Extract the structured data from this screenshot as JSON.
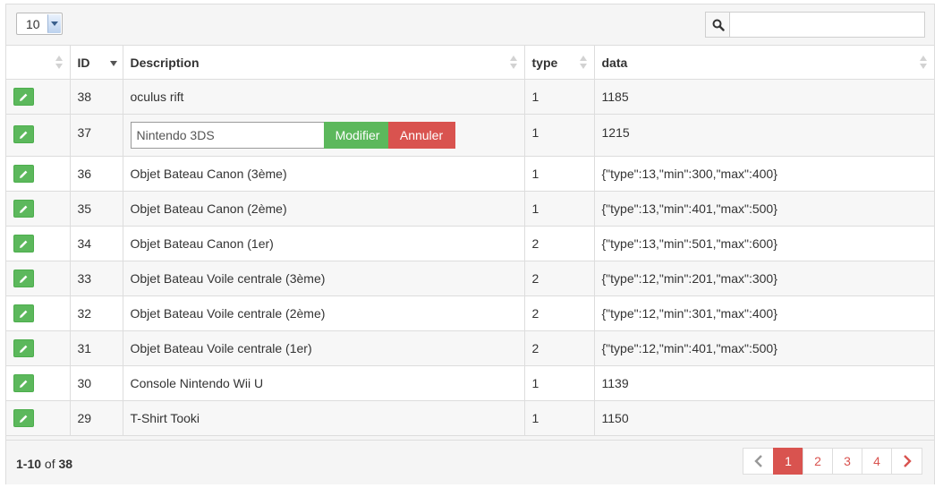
{
  "toolbar": {
    "page_size_value": "10",
    "search_placeholder": "",
    "search_icon": "search-icon"
  },
  "table": {
    "headers": {
      "actions": "",
      "id": "ID",
      "description": "Description",
      "type": "type",
      "data": "data"
    },
    "rows": [
      {
        "id": "38",
        "description": "oculus rift",
        "type": "1",
        "data": "1185"
      },
      {
        "id": "37",
        "description": "Nintendo 3DS",
        "type": "1",
        "data": "1215"
      },
      {
        "id": "36",
        "description": "Objet Bateau Canon (3ème)",
        "type": "1",
        "data": "{\"type\":13,\"min\":300,\"max\":400}"
      },
      {
        "id": "35",
        "description": "Objet Bateau Canon (2ème)",
        "type": "1",
        "data": "{\"type\":13,\"min\":401,\"max\":500}"
      },
      {
        "id": "34",
        "description": "Objet Bateau Canon (1er)",
        "type": "2",
        "data": "{\"type\":13,\"min\":501,\"max\":600}"
      },
      {
        "id": "33",
        "description": "Objet Bateau Voile centrale (3ème)",
        "type": "2",
        "data": "{\"type\":12,\"min\":201,\"max\":300}"
      },
      {
        "id": "32",
        "description": "Objet Bateau Voile centrale (2ème)",
        "type": "2",
        "data": "{\"type\":12,\"min\":301,\"max\":400}"
      },
      {
        "id": "31",
        "description": "Objet Bateau Voile centrale (1er)",
        "type": "2",
        "data": "{\"type\":12,\"min\":401,\"max\":500}"
      },
      {
        "id": "30",
        "description": "Console Nintendo Wii U",
        "type": "1",
        "data": "1139"
      },
      {
        "id": "29",
        "description": "T-Shirt Tooki",
        "type": "1",
        "data": "1150"
      }
    ],
    "inline_edit": {
      "value": "Nintendo 3DS",
      "modify_label": "Modifier",
      "cancel_label": "Annuler"
    }
  },
  "footer": {
    "range": "1-10",
    "of_label": "of",
    "total": "38",
    "pages": [
      "1",
      "2",
      "3",
      "4"
    ],
    "active_page": "1"
  },
  "colors": {
    "accent_green": "#5cb85c",
    "accent_red": "#d9534f"
  }
}
